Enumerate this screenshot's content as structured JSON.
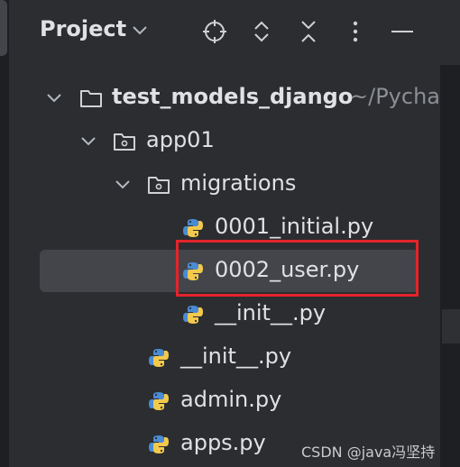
{
  "panel": {
    "title": "Project"
  },
  "toolbar": {
    "icons": [
      "crosshair-icon",
      "expand-collapse-icon",
      "collapse-all-icon",
      "more-icon",
      "minimize-icon"
    ]
  },
  "tree": {
    "root": {
      "label": "test_models_django",
      "path_hint": "~/Pycha"
    },
    "app01": {
      "label": "app01"
    },
    "migrations": {
      "label": "migrations"
    },
    "file_0001": {
      "label": "0001_initial.py"
    },
    "file_0002": {
      "label": "0002_user.py"
    },
    "file_mig_init": {
      "label": "__init__.py"
    },
    "file_app_init": {
      "label": "__init__.py"
    },
    "file_admin": {
      "label": "admin.py"
    },
    "file_apps": {
      "label": "apps.py"
    }
  },
  "watermark": "CSDN @java冯坚持",
  "colors": {
    "background": "#2b2d30",
    "selection": "#43454a",
    "highlight_border": "#e5242b",
    "python_blue": "#4a8bd4",
    "python_yellow": "#f2c94c"
  }
}
